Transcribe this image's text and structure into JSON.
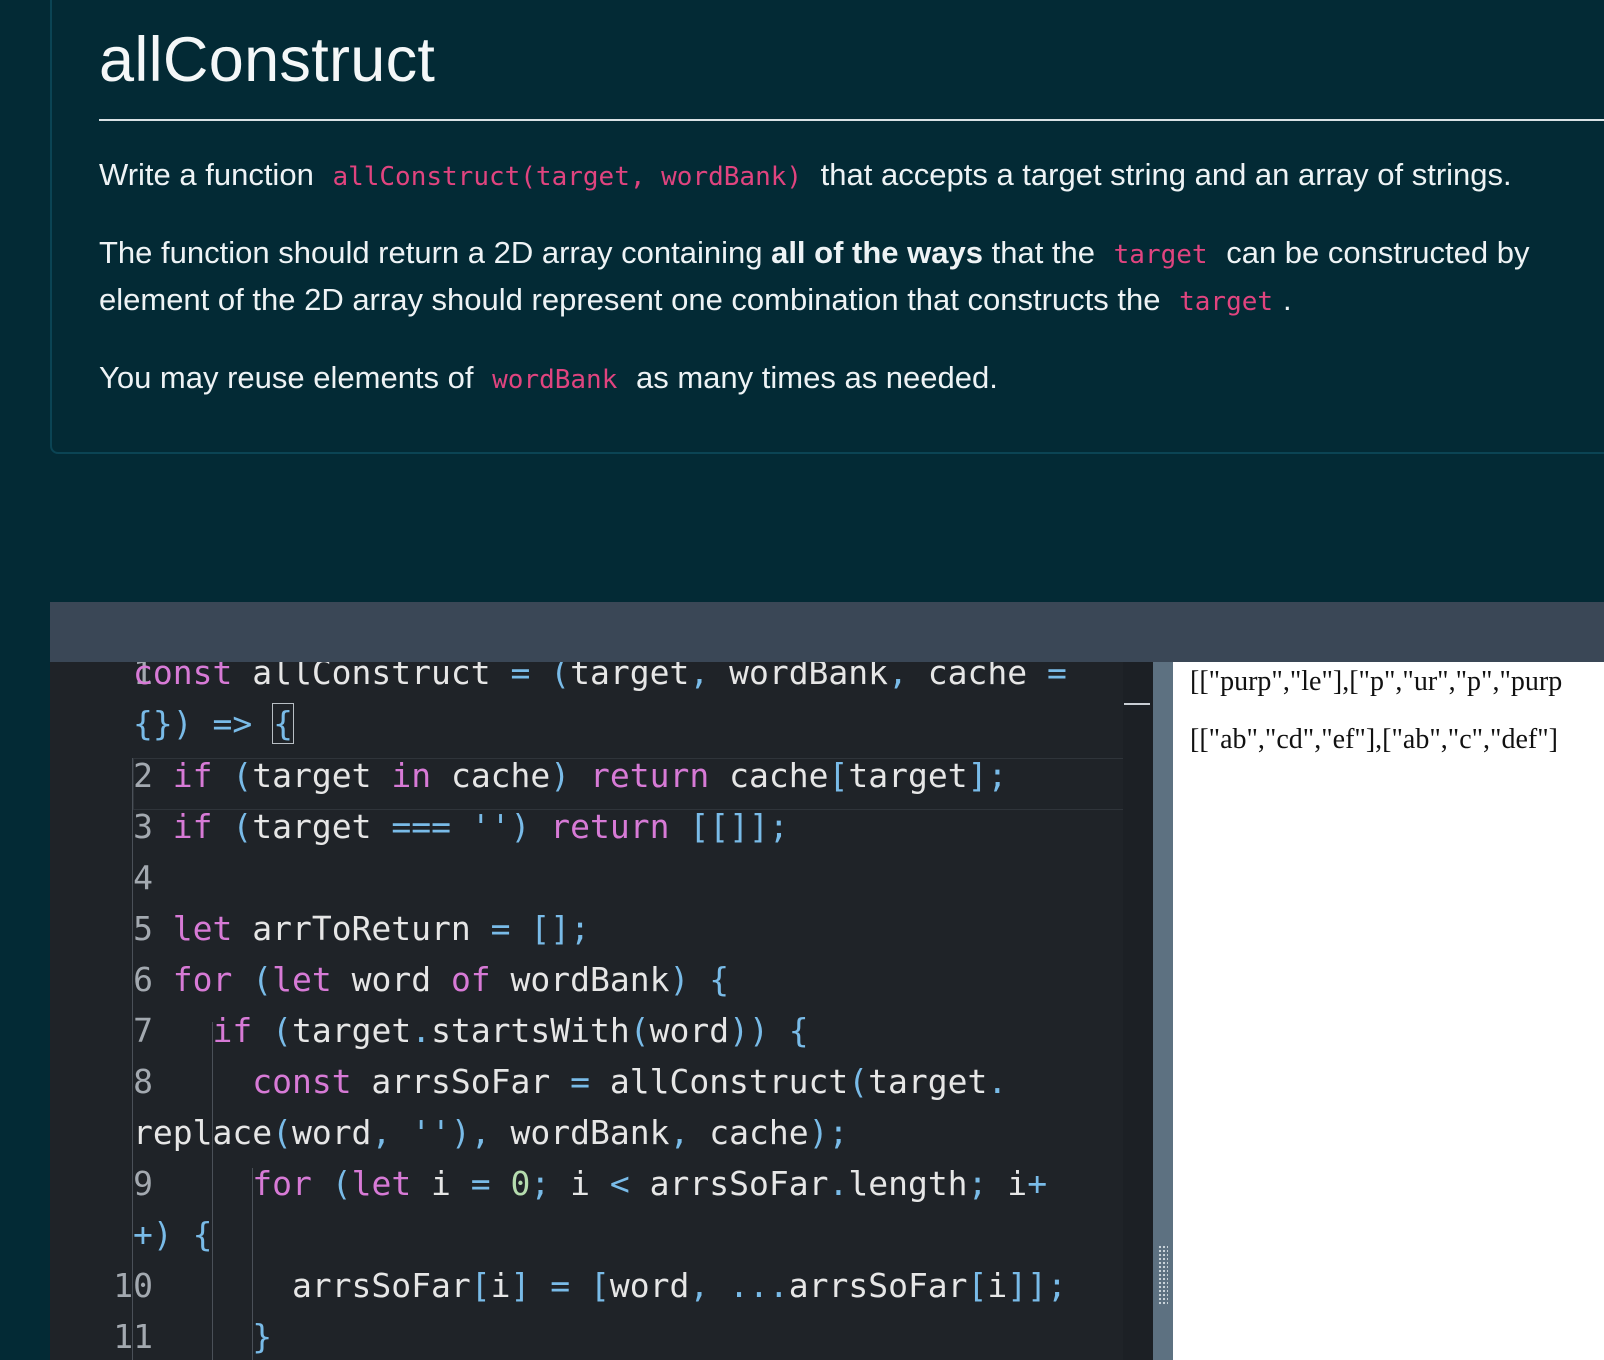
{
  "problem": {
    "title": "allConstruct",
    "p1": {
      "a": "Write a function",
      "code": "allConstruct(target, wordBank)",
      "b": "that accepts a target string and an array of strings."
    },
    "p2": {
      "a": "The function should return a 2D array containing",
      "bold": "all of the ways",
      "b": "that the",
      "code": "target",
      "c": "can be constructed by"
    },
    "p3": {
      "a": "element of the 2D array should represent one combination that constructs the",
      "code": "target",
      "b": "."
    },
    "p4": {
      "a": "You may reuse elements of",
      "code": "wordBank",
      "b": "as many times as needed."
    }
  },
  "editor": {
    "line_numbers": [
      "1",
      "2",
      "3",
      "4",
      "5",
      "6",
      "7",
      "8",
      "9",
      "10",
      "11"
    ]
  },
  "output": {
    "lines": [
      "[[\"purp\",\"le\"],[\"p\",\"ur\",\"p\",\"purp",
      "[[\"ab\",\"cd\",\"ef\"],[\"ab\",\"c\",\"def\"]"
    ]
  }
}
